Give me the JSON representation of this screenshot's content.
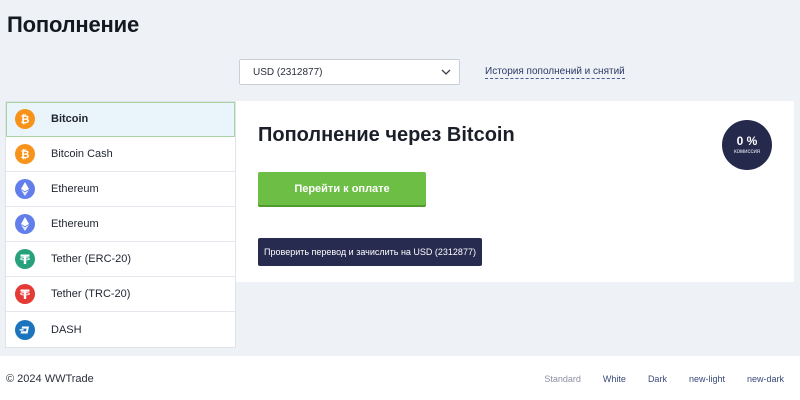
{
  "page": {
    "title": "Пополнение"
  },
  "account_select": {
    "value": "USD (2312877)"
  },
  "history_link": {
    "label": "История пополнений и снятий"
  },
  "methods": [
    {
      "label": "Bitcoin",
      "icon": "bitcoin-icon",
      "color": "#f7931a",
      "active": true
    },
    {
      "label": "Bitcoin Cash",
      "icon": "bitcoin-cash-icon",
      "color": "#f7931a",
      "active": false
    },
    {
      "label": "Ethereum",
      "icon": "ethereum-icon",
      "color": "#627eea",
      "active": false
    },
    {
      "label": "Ethereum",
      "icon": "ethereum-icon",
      "color": "#627eea",
      "active": false
    },
    {
      "label": "Tether (ERC-20)",
      "icon": "tether-icon",
      "color": "#26a17b",
      "active": false
    },
    {
      "label": "Tether (TRC-20)",
      "icon": "tether-icon",
      "color": "#e53935",
      "active": false
    },
    {
      "label": "DASH",
      "icon": "dash-icon",
      "color": "#1c75bc",
      "active": false
    }
  ],
  "panel": {
    "title": "Пополнение через Bitcoin",
    "fee_value": "0 %",
    "fee_label": "комиссия",
    "pay_button": "Перейти к оплате",
    "verify_button": "Проверить перевод и зачислить на USD (2312877)"
  },
  "footer": {
    "copyright": "© 2024 WWTrade",
    "themes": [
      {
        "label": "Standard",
        "current": true
      },
      {
        "label": "White",
        "current": false
      },
      {
        "label": "Dark",
        "current": false
      },
      {
        "label": "new-light",
        "current": false
      },
      {
        "label": "new-dark",
        "current": false
      }
    ]
  },
  "colors": {
    "accent_green": "#6dbe45",
    "navy": "#252a4d",
    "background": "#eef1f6"
  }
}
